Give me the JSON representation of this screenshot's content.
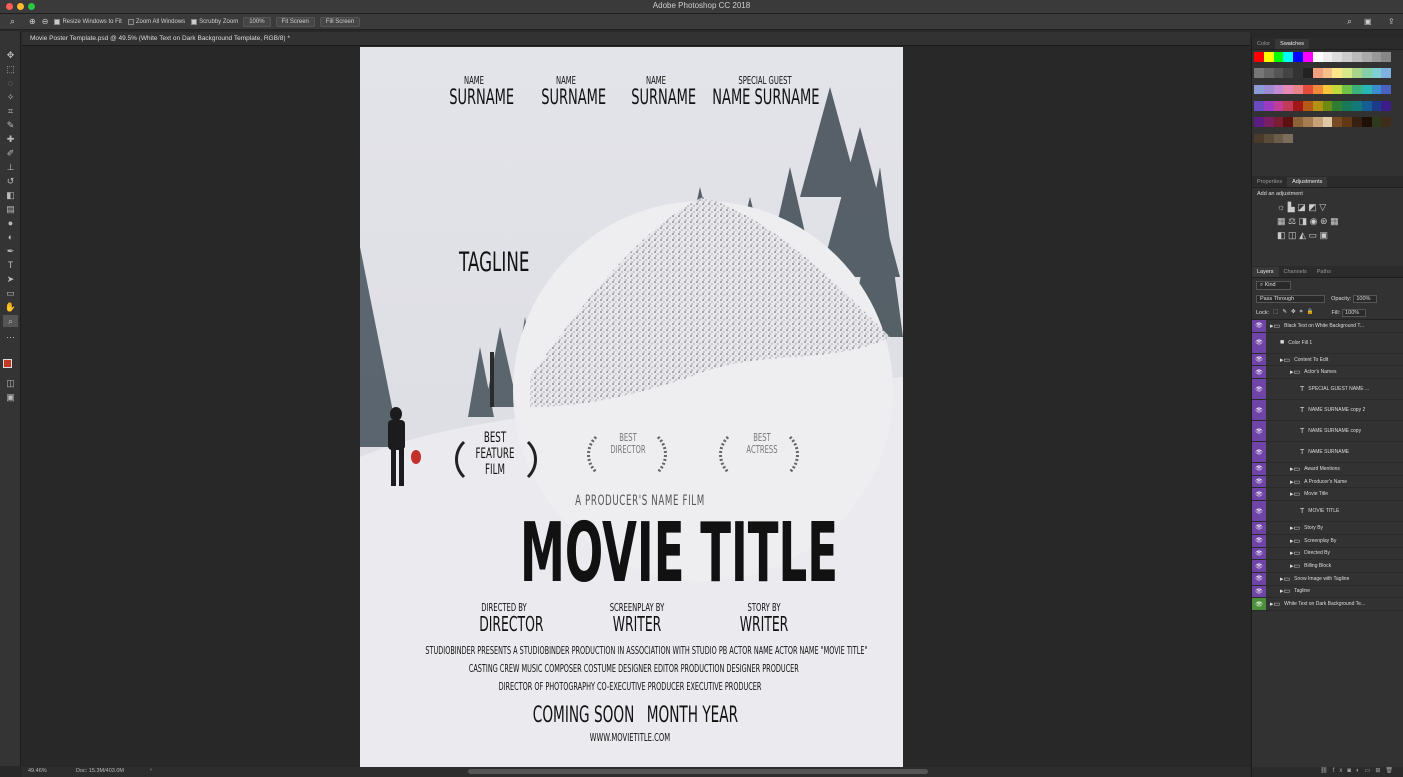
{
  "app": {
    "title": "Adobe Photoshop CC 2018"
  },
  "options": {
    "resize": "Resize Windows to Fit",
    "zoom_all": "Zoom All Windows",
    "scrubby": "Scrubby Zoom",
    "pct": "100%",
    "fit": "Fit Screen",
    "fill": "Fill Screen"
  },
  "document": {
    "tab": "Movie Poster Template.psd @ 49.5% (White Text on Dark Background Template, RGB/8) *"
  },
  "status": {
    "zoom": "49.46%",
    "doc": "Doc: 15.3M/403.0M"
  },
  "poster": {
    "cast": [
      {
        "top": "NAME",
        "bottom": "SURNAME"
      },
      {
        "top": "NAME",
        "bottom": "SURNAME"
      },
      {
        "top": "NAME",
        "bottom": "SURNAME"
      },
      {
        "top": "SPECIAL GUEST",
        "bottom": "NAME SURNAME"
      }
    ],
    "tagline": "TAGLINE",
    "award": "BEST FEATURE FILM",
    "award2": "BEST DIRECTOR",
    "award3": "BEST ACTRESS",
    "producer_line": "A PRODUCER'S NAME FILM",
    "movie_title": "MOVIE TITLE",
    "credits": [
      {
        "top": "DIRECTED BY",
        "bottom": "DIRECTOR"
      },
      {
        "top": "SCREENPLAY BY",
        "bottom": "WRITER"
      },
      {
        "top": "STORY BY",
        "bottom": "WRITER"
      }
    ],
    "billing1": "STUDIOBINDER PRESENTS A STUDIOBINDER PRODUCTION IN ASSOCIATION WITH STUDIO PB ACTOR NAME ACTOR NAME \"MOVIE TITLE\"",
    "billing2": "CASTING CREW  MUSIC COMPOSER  COSTUME DESIGNER  EDITOR  PRODUCTION DESIGNER  PRODUCER",
    "billing3": "DIRECTOR OF PHOTOGRAPHY  CO-EXECUTIVE PRODUCER  EXECUTIVE PRODUCER",
    "coming": "COMING SOON",
    "month": "MONTH YEAR",
    "url": "WWW.MOVIETITLE.COM"
  },
  "panels": {
    "tab_color": "Color",
    "tab_swatches": "Swatches",
    "tab_properties": "Properties",
    "tab_adjustments": "Adjustments",
    "add_adj": "Add an adjustment",
    "tab_layers": "Layers",
    "tab_channels": "Channels",
    "tab_paths": "Paths",
    "kind": "Kind",
    "blend": "Pass Through",
    "opacity_label": "Opacity:",
    "opacity": "100%",
    "lock": "Lock:",
    "fill_label": "Fill:",
    "fill": "100%"
  },
  "swatches": [
    "#ff0000",
    "#ffff00",
    "#00ff00",
    "#00ffff",
    "#0000ff",
    "#ff00ff",
    "#ffffff",
    "#eeeeee",
    "#dddddd",
    "#cccccc",
    "#bbbbbb",
    "#aaaaaa",
    "#999999",
    "#888888",
    "#777777",
    "#666666",
    "#555555",
    "#444444",
    "#333333",
    "#222222",
    "#f2a07e",
    "#f7c08a",
    "#fde68a",
    "#d7e98a",
    "#a8d58a",
    "#87cfa7",
    "#7fd0d2",
    "#7fb2e0",
    "#8a9bd6",
    "#9d8ad3",
    "#c18ad3",
    "#e58ab8",
    "#e8848a",
    "#e34b3b",
    "#f08a3b",
    "#f6c53b",
    "#c1d93b",
    "#6ec24a",
    "#3bb27b",
    "#2ab5b5",
    "#3b8dd0",
    "#4a63c2",
    "#6a4ac2",
    "#9a3bc2",
    "#c23b96",
    "#c23b56",
    "#a11818",
    "#b45a16",
    "#b39212",
    "#6d8a15",
    "#2d7d32",
    "#15795a",
    "#137878",
    "#155d94",
    "#1e3a8a",
    "#3b1e8a",
    "#5e1b80",
    "#7a1e62",
    "#7a1e32",
    "#5e1010",
    "#8c6239",
    "#a67c52",
    "#c7a17a",
    "#e0c9a6",
    "#754c24",
    "#603813",
    "#362011",
    "#1e1006",
    "#2e3a1e",
    "#3e2b1a",
    "#4a3a2a",
    "#5a4a3a",
    "#6b5b4b",
    "#7c6c5c"
  ],
  "layers": [
    {
      "name": "Black Text on White Background T...",
      "indent": 0,
      "icon": "folder"
    },
    {
      "name": "Color Fill 1",
      "indent": 1,
      "icon": "fill"
    },
    {
      "name": "Content To Edit",
      "indent": 1,
      "icon": "folder"
    },
    {
      "name": "Actor's Names",
      "indent": 2,
      "icon": "folder"
    },
    {
      "name": "SPECIAL GUEST NAME ...",
      "indent": 3,
      "icon": "T"
    },
    {
      "name": "NAME SURNAME copy 2",
      "indent": 3,
      "icon": "T"
    },
    {
      "name": "NAME SURNAME copy",
      "indent": 3,
      "icon": "T"
    },
    {
      "name": "NAME SURNAME",
      "indent": 3,
      "icon": "T"
    },
    {
      "name": "Award Mentions",
      "indent": 2,
      "icon": "folder"
    },
    {
      "name": "A Producer's Name",
      "indent": 2,
      "icon": "folder"
    },
    {
      "name": "Movie Title",
      "indent": 2,
      "icon": "folder"
    },
    {
      "name": "MOVIE TITLE",
      "indent": 3,
      "icon": "T"
    },
    {
      "name": "Story By",
      "indent": 2,
      "icon": "folder"
    },
    {
      "name": "Screenplay By",
      "indent": 2,
      "icon": "folder"
    },
    {
      "name": "Directed By",
      "indent": 2,
      "icon": "folder"
    },
    {
      "name": "Billing Block",
      "indent": 2,
      "icon": "folder"
    },
    {
      "name": "Snow Image with Tagline",
      "indent": 1,
      "icon": "folder"
    },
    {
      "name": "Tagline",
      "indent": 1,
      "icon": "folder"
    },
    {
      "name": "White Text on Dark Background Te...",
      "indent": 0,
      "icon": "folder"
    }
  ]
}
